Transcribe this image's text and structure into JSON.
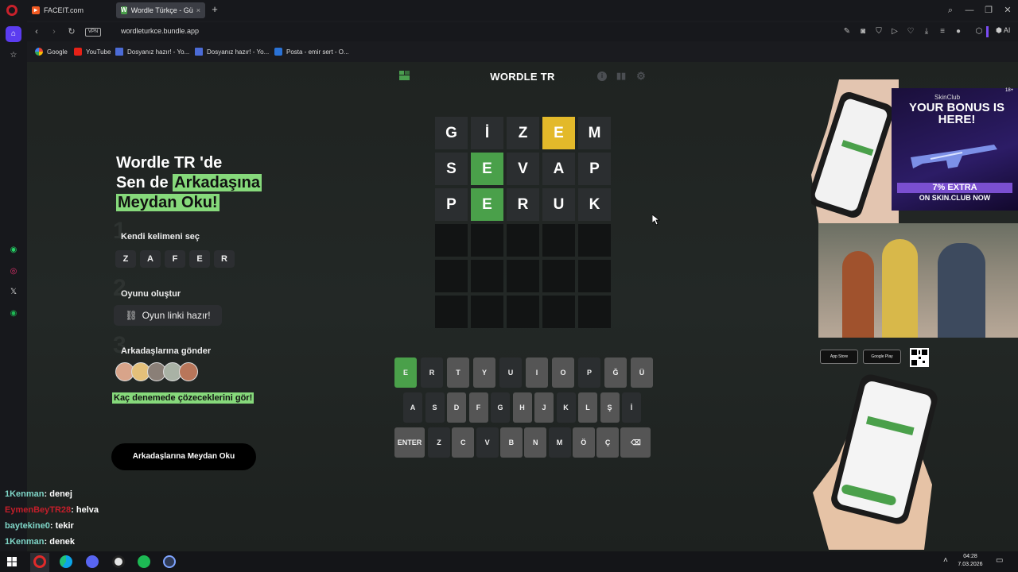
{
  "browser": {
    "tabs": [
      {
        "label": "FACEIT.com"
      },
      {
        "label": "Wordle Türkçe - Günlük K"
      }
    ],
    "tab_close": "×",
    "new_tab": "+",
    "url": "wordleturkce.bundle.app",
    "vpn": "VPN",
    "ai_label": "AI",
    "bookmarks": [
      {
        "label": "Google"
      },
      {
        "label": "YouTube"
      },
      {
        "label": "Dosyanız hazır! - Yo..."
      },
      {
        "label": "Dosyanız hazır! - Yo..."
      },
      {
        "label": "Posta - emir sert - O..."
      }
    ]
  },
  "site": {
    "title": "WORDLE TR"
  },
  "promo": {
    "title_line1": "Wordle TR 'de",
    "title_line2_plain": "Sen de ",
    "title_line2_hl": "Arkadaşına",
    "title_line3_hl": "Meydan Oku!",
    "step1_label": "Kendi kelimeni seç",
    "step1_num": "1",
    "step1_letters": [
      "Z",
      "A",
      "F",
      "E",
      "R"
    ],
    "step2_label": "Oyunu oluştur",
    "step2_num": "2",
    "link_button": "Oyun linki hazır!",
    "step3_label": "Arkadaşlarına gönder",
    "step3_num": "3",
    "result_text": "Kaç denemede çözeceklerini gör!",
    "challenge_button": "Arkadaşlarına Meydan Oku"
  },
  "board": {
    "rows": [
      [
        {
          "l": "G",
          "s": "absent"
        },
        {
          "l": "İ",
          "s": "absent"
        },
        {
          "l": "Z",
          "s": "absent"
        },
        {
          "l": "E",
          "s": "present"
        },
        {
          "l": "M",
          "s": "absent"
        }
      ],
      [
        {
          "l": "S",
          "s": "absent"
        },
        {
          "l": "E",
          "s": "correct"
        },
        {
          "l": "V",
          "s": "absent"
        },
        {
          "l": "A",
          "s": "absent"
        },
        {
          "l": "P",
          "s": "absent"
        }
      ],
      [
        {
          "l": "P",
          "s": "absent"
        },
        {
          "l": "E",
          "s": "correct"
        },
        {
          "l": "R",
          "s": "absent"
        },
        {
          "l": "U",
          "s": "absent"
        },
        {
          "l": "K",
          "s": "absent"
        }
      ],
      [
        {
          "l": "",
          "s": "empty"
        },
        {
          "l": "",
          "s": "empty"
        },
        {
          "l": "",
          "s": "empty"
        },
        {
          "l": "",
          "s": "empty"
        },
        {
          "l": "",
          "s": "empty"
        }
      ],
      [
        {
          "l": "",
          "s": "empty"
        },
        {
          "l": "",
          "s": "empty"
        },
        {
          "l": "",
          "s": "empty"
        },
        {
          "l": "",
          "s": "empty"
        },
        {
          "l": "",
          "s": "empty"
        }
      ],
      [
        {
          "l": "",
          "s": "empty"
        },
        {
          "l": "",
          "s": "empty"
        },
        {
          "l": "",
          "s": "empty"
        },
        {
          "l": "",
          "s": "empty"
        },
        {
          "l": "",
          "s": "empty"
        }
      ]
    ],
    "colors": {
      "correct": "#4aa04a",
      "present": "#e3b92a",
      "absent": "#2b2e30",
      "empty": "#121414"
    }
  },
  "keyboard": {
    "rows": [
      [
        {
          "k": "E",
          "s": "correct"
        },
        {
          "k": "R",
          "s": "absent"
        },
        {
          "k": "T",
          "s": "default"
        },
        {
          "k": "Y",
          "s": "default"
        },
        {
          "k": "U",
          "s": "absent"
        },
        {
          "k": "I",
          "s": "default"
        },
        {
          "k": "O",
          "s": "default"
        },
        {
          "k": "P",
          "s": "absent"
        },
        {
          "k": "Ğ",
          "s": "default"
        },
        {
          "k": "Ü",
          "s": "default"
        }
      ],
      [
        {
          "k": "A",
          "s": "absent"
        },
        {
          "k": "S",
          "s": "absent"
        },
        {
          "k": "D",
          "s": "default"
        },
        {
          "k": "F",
          "s": "default"
        },
        {
          "k": "G",
          "s": "absent"
        },
        {
          "k": "H",
          "s": "default"
        },
        {
          "k": "J",
          "s": "default"
        },
        {
          "k": "K",
          "s": "absent"
        },
        {
          "k": "L",
          "s": "default"
        },
        {
          "k": "Ş",
          "s": "default"
        },
        {
          "k": "İ",
          "s": "absent"
        }
      ],
      [
        {
          "k": "ENTER",
          "s": "default"
        },
        {
          "k": "Z",
          "s": "absent"
        },
        {
          "k": "C",
          "s": "default"
        },
        {
          "k": "V",
          "s": "absent"
        },
        {
          "k": "B",
          "s": "default"
        },
        {
          "k": "N",
          "s": "default"
        },
        {
          "k": "M",
          "s": "absent"
        },
        {
          "k": "Ö",
          "s": "default"
        },
        {
          "k": "Ç",
          "s": "default"
        },
        {
          "k": "⌫",
          "s": "default"
        }
      ]
    ]
  },
  "ads": {
    "brand": "SkinClub",
    "headline": "YOUR BONUS IS HERE!",
    "extra": "7% EXTRA",
    "sub": "ON SKIN.CLUB NOW",
    "age": "18+",
    "app_store": "App Store",
    "google_play": "Google Play"
  },
  "chat": [
    {
      "user": "1Kenman",
      "msg": ": denej",
      "color": "#7fd6c8"
    },
    {
      "user": "EymenBeyTR28",
      "msg": ": helva",
      "color": "#c41e2a"
    },
    {
      "user": "baytekine0",
      "msg": ": tekir",
      "color": "#7fd6c8"
    },
    {
      "user": "1Kenman",
      "msg": ": denek",
      "color": "#7fd6c8"
    }
  ],
  "taskbar": {
    "time": "04:28",
    "date": "7.03.2026"
  }
}
